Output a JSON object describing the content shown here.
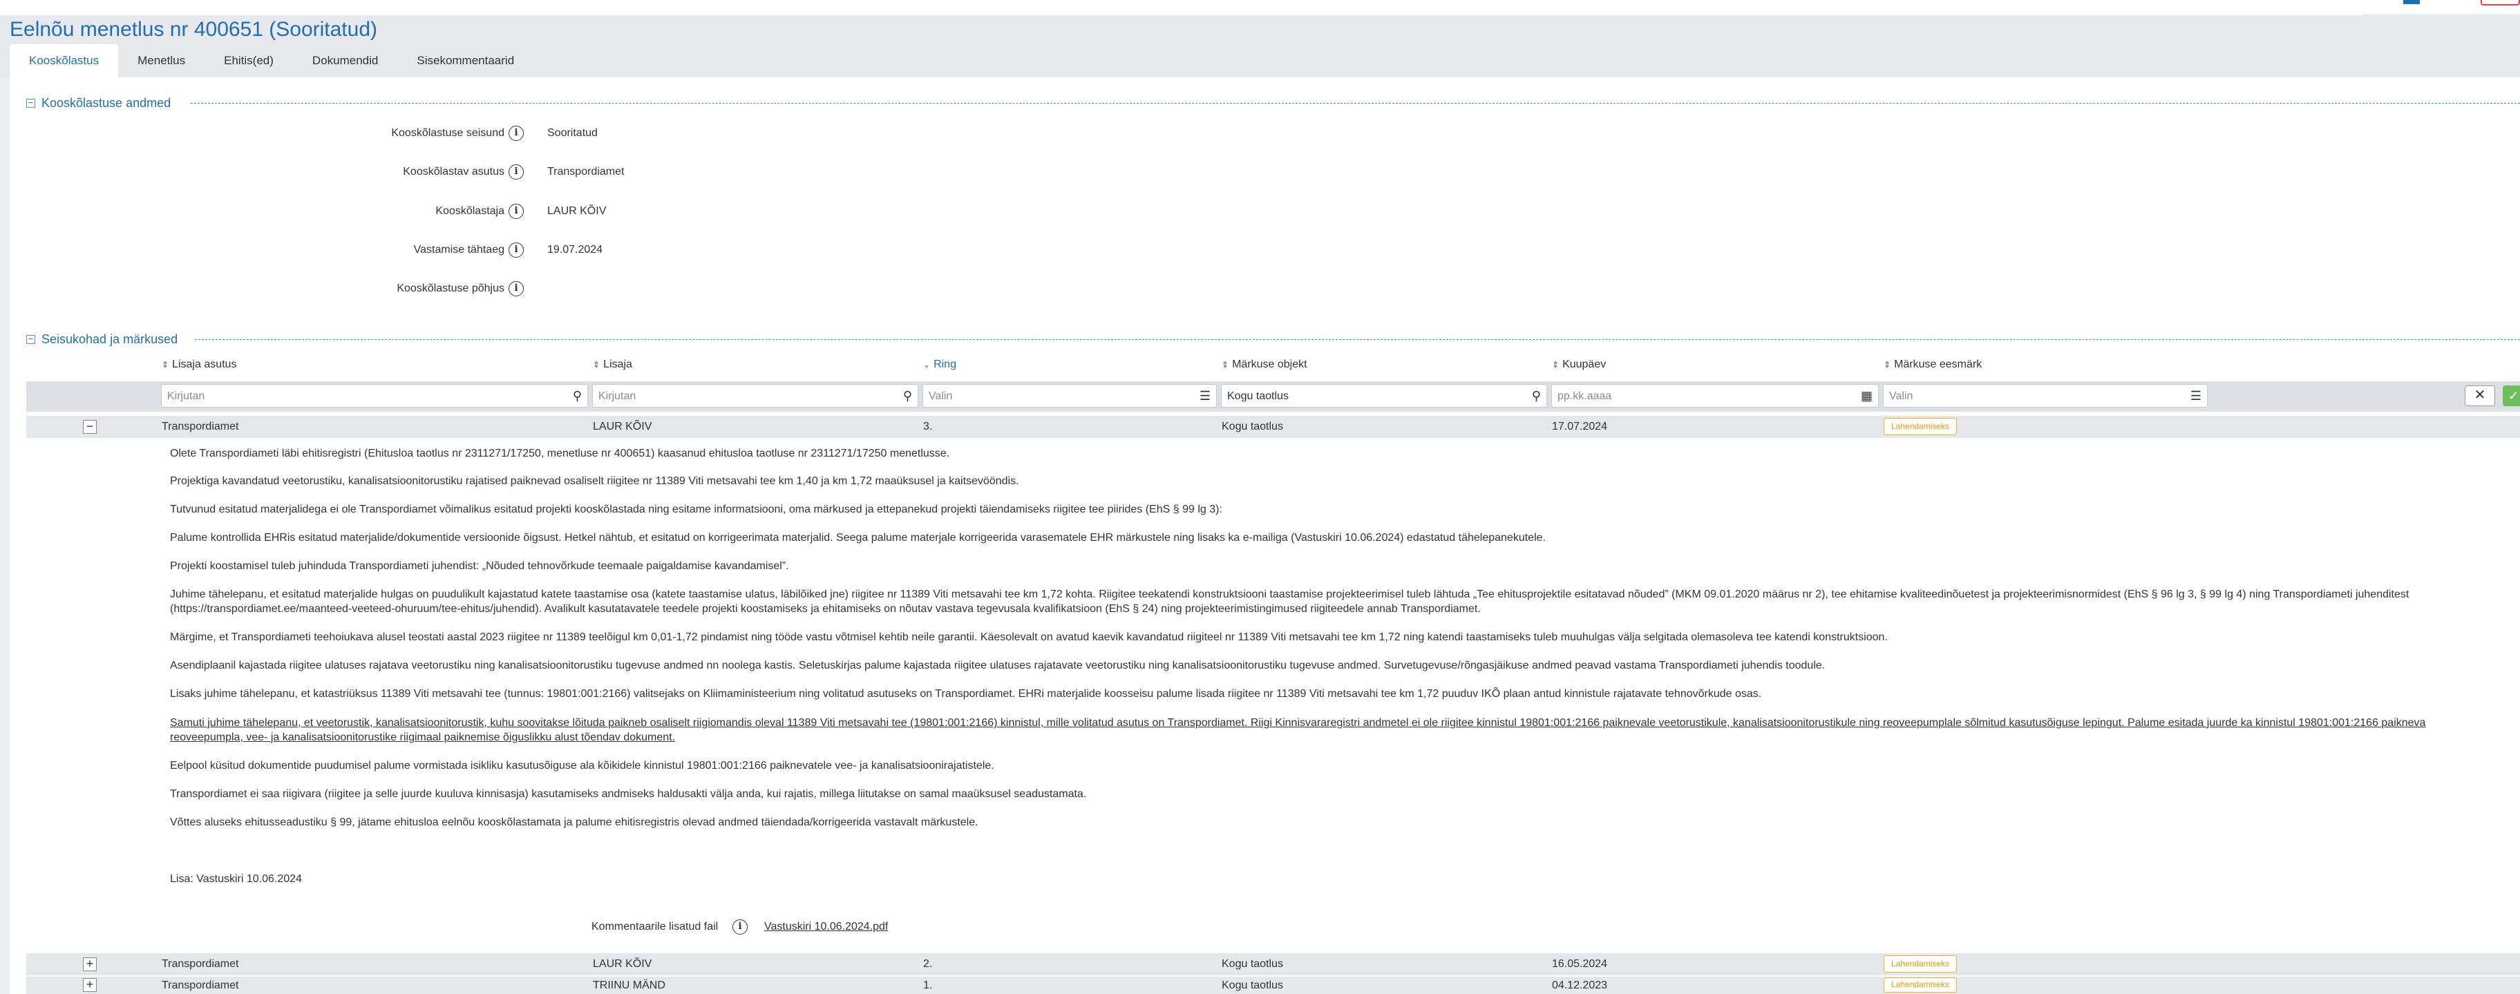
{
  "header": {
    "title": "Eelnõu menetlus nr 400651 (Sooritatud)",
    "tabs": [
      {
        "label": "Kooskõlastus",
        "active": true
      },
      {
        "label": "Menetlus"
      },
      {
        "label": "Ehitis(ed)"
      },
      {
        "label": "Dokumendid"
      },
      {
        "label": "Sisekommentaarid"
      }
    ]
  },
  "approval_section": {
    "legend": "Kooskõlastuse andmed",
    "toggle_symbol": "−",
    "fields": [
      {
        "label": "Kooskõlastuse seisund",
        "value": "Sooritatud"
      },
      {
        "label": "Kooskõlastav asutus",
        "value": "Transpordiamet"
      },
      {
        "label": "Kooskõlastaja",
        "value": "LAUR KÕIV"
      },
      {
        "label": "Vastamise tähtaeg",
        "value": "19.07.2024"
      },
      {
        "label": "Kooskõlastuse põhjus",
        "value": ""
      }
    ]
  },
  "comments_section": {
    "legend": "Seisukohad ja märkused",
    "toggle_symbol": "−",
    "columns": [
      {
        "label": "Lisaja asutus",
        "sort": "⇕"
      },
      {
        "label": "Lisaja",
        "sort": "⇕"
      },
      {
        "label": "Ring",
        "sort": "⌄",
        "active": true
      },
      {
        "label": "Märkuse objekt",
        "sort": "⇕"
      },
      {
        "label": "Kuupäev",
        "sort": "⇕"
      },
      {
        "label": "Märkuse eesmärk",
        "sort": "⇕"
      }
    ],
    "filters": {
      "asutus_placeholder": "Kirjutan",
      "lisaja_placeholder": "Kirjutan",
      "ring_placeholder": "Valin",
      "objekt_value": "Kogu taotlus",
      "kuupaev_placeholder": "pp.kk.aaaa",
      "eesmark_placeholder": "Valin",
      "clear_label": "✕",
      "apply_label": "✓"
    },
    "rows": [
      {
        "toggle": "−",
        "asutus": "Transpordiamet",
        "lisaja": "LAUR KÕIV",
        "ring": "3.",
        "objekt": "Kogu taotlus",
        "kuupaev": "17.07.2024",
        "eesmark": "Lahendamiseks"
      },
      {
        "toggle": "+",
        "asutus": "Transpordiamet",
        "lisaja": "LAUR KÕIV",
        "ring": "2.",
        "objekt": "Kogu taotlus",
        "kuupaev": "16.05.2024",
        "eesmark": "Lahendamiseks"
      },
      {
        "toggle": "+",
        "asutus": "Transpordiamet",
        "lisaja": "TRIINU MÄND",
        "ring": "1.",
        "objekt": "Kogu taotlus",
        "kuupaev": "04.12.2023",
        "eesmark": "Lahendamiseks"
      }
    ],
    "expanded_detail": {
      "paragraphs": [
        "Olete Transpordiameti läbi ehitisregistri (Ehitusloa taotlus nr 2311271/17250, menetluse nr 400651) kaasanud ehitusloa taotluse nr 2311271/17250 menetlusse.",
        "Projektiga kavandatud veetorustiku, kanalisatsioonitorustiku rajatised paiknevad osaliselt riigitee nr 11389 Viti metsavahi tee km 1,40 ja km 1,72 maaüksusel ja kaitsevööndis.",
        "Tutvunud esitatud materjalidega ei ole Transpordiamet võimalikus esitatud projekti kooskõlastada ning esitame informatsiooni, oma märkused ja ettepanekud projekti täiendamiseks riigitee tee piirides (EhS § 99 lg 3):",
        "Palume kontrollida EHRis esitatud materjalide/dokumentide versioonide õigsust. Hetkel nähtub, et esitatud on korrigeerimata materjalid. Seega palume materjale korrigeerida varasematele EHR märkustele ning lisaks ka e-mailiga (Vastuskiri 10.06.2024) edastatud tähelepanekutele.",
        "Projekti koostamisel tuleb juhinduda Transpordiameti juhendist: „Nõuded tehnovõrkude teemaale paigaldamise kavandamisel”.",
        "Juhime tähelepanu, et esitatud materjalide hulgas on puudulikult kajastatud katete taastamise osa (katete taastamise ulatus, läbilõiked jne) riigitee nr 11389 Viti metsavahi tee km 1,72 kohta. Riigitee teekatendi konstruktsiooni taastamise projekteerimisel tuleb lähtuda „Tee ehitusprojektile esitatavad nõuded” (MKM 09.01.2020 määrus nr 2), tee ehitamise kvaliteedinõuetest ja projekteerimisnormidest (EhS § 96 lg 3, § 99 lg 4) ning Transpordiameti juhenditest (https://transpordiamet.ee/maanteed-veeteed-ohuruum/tee-ehitus/juhendid). Avalikult kasutatavatele teedele projekti koostamiseks ja ehitamiseks on nõutav vastava tegevusala kvalifikatsioon (EhS § 24) ning projekteerimistingimused riigiteedele annab Transpordiamet.",
        "Märgime, et Transpordiameti teehoiukava alusel teostati aastal 2023 riigitee nr 11389 teelõigul km 0,01-1,72 pindamist ning tööde vastu võtmisel kehtib neile garantii. Käesolevalt on avatud kaevik kavandatud riigiteel nr 11389 Viti metsavahi tee km 1,72 ning katendi taastamiseks tuleb muuhulgas välja selgitada olemasoleva tee katendi konstruktsioon.",
        "Asendiplaanil kajastada riigitee ulatuses rajatava veetorustiku ning kanalisatsioonitorustiku tugevuse andmed nn noolega kastis. Seletuskirjas palume kajastada riigitee ulatuses rajatavate veetorustiku ning kanalisatsioonitorustiku tugevuse andmed. Surve­tugevuse/rõngasjäikuse andmed peavad vastama Transpordiameti juhendis toodule.",
        "Lisaks juhime tähelepanu, et katastriüksus 11389 Viti metsavahi tee (tunnus: 19801:001:2166) valitsejaks on Kliimaministeerium ning volitatud asutuseks on Transpordiamet. EHRi materjalide koosseisu palume lisada riigitee nr 11389 Viti metsavahi tee km 1,72 puuduv IKÕ plaan antud kinnistule rajatavate tehnovõrkude osas.",
        "Samuti juhime tähelepanu, et veetorustik, kanalisatsioonitorustik, kuhu soovitakse lõ­ituda paikneb osaliselt riigiomandis oleval 11389 Viti metsavahi tee (19801:001:2166) kinnistul, mille volitatud asutus on Transpordiamet. Riigi Kinnisvararegistri andmetel ei ole riigitee kinnistul 19801:001:2166 paiknevale veetorustikule, kanalisatsioonitorustikule ning reoveepumplale sõlmitud kasutusõiguse lepingut. Palume esitada juurde ka kinnistul 19801:001:2166 paikneva reoveepumpla, vee- ja kanalisatsioonitorustike riigimaal paiknemise õiguslikku alust tõendav dokument.",
        "Eelpool küsitud dokumentide puudumisel palume vormistada isikliku kasutusõiguse ala kõikidele kinnistul 19801:001:2166 paiknevatele vee- ja kanalisatsioonirajatistele.",
        "Transpordiamet ei saa riigivara (riigitee ja selle juurde kuuluva kinnisasja) kasutamiseks andmiseks haldusakti välja anda, kui rajatis, millega liitutakse on samal maaüksusel seadustamata.",
        "Võttes aluseks ehitusseadustiku § 99, jätame ehitusloa eelnõu kooskõlastamata ja palume ehitisregistris olevad andmed täiendada/korrigeerida vastavalt märkustele."
      ],
      "lisa": "Lisa: Vastuskiri 10.06.2024",
      "attachment_label": "Kommentaarile lisatud fail",
      "attachment_file": "Vastuskiri 10.06.2024.pdf"
    }
  },
  "colors": {
    "accent": "#1f6fb0",
    "header_bg": "#e7e9ec",
    "row_bg": "#e5e7ea",
    "badge": "#f2b321",
    "apply_green": "#6cbf5a"
  },
  "icons": {
    "info": "info-circle-icon",
    "search": "search-icon",
    "list": "list-icon",
    "calendar": "calendar-icon",
    "sort": "sort-arrows-icon"
  }
}
